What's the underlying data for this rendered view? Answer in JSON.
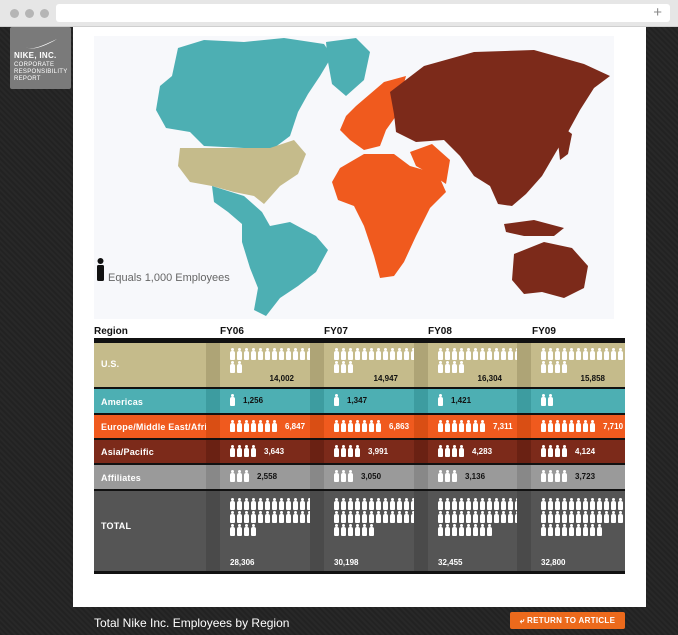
{
  "brand": {
    "name": "NIKE, INC.",
    "subtitle": "CORPORATE RESPONSIBILITY REPORT"
  },
  "legend": {
    "text": "Equals 1,000 Employees"
  },
  "table": {
    "region_header": "Region",
    "years": [
      "FY06",
      "FY07",
      "FY08",
      "FY09"
    ],
    "rows": [
      {
        "label": "U.S.",
        "values": [
          "14,002",
          "14,947",
          "16,304",
          "15,858"
        ],
        "color": "#c5bb8b",
        "shade": "#aea476"
      },
      {
        "label": "Americas",
        "values": [
          "1,256",
          "1,347",
          "1,421",
          ""
        ],
        "color": "#4dafb3",
        "shade": "#3d9ca0"
      },
      {
        "label": "Europe/Middle East/Africa",
        "values": [
          "6,847",
          "6,863",
          "7,311",
          "7,710"
        ],
        "color": "#f05a1e",
        "shade": "#d94e14"
      },
      {
        "label": "Asia/Pacific",
        "values": [
          "3,643",
          "3,991",
          "4,283",
          "4,124"
        ],
        "color": "#7c2a1a",
        "shade": "#6a2113"
      },
      {
        "label": "Affiliates",
        "values": [
          "2,558",
          "3,050",
          "3,136",
          "3,723"
        ],
        "color": "#9a9a9a",
        "shade": "#888888"
      },
      {
        "label": "TOTAL",
        "values": [
          "28,306",
          "30,198",
          "32,455",
          "32,800"
        ],
        "color": "#555555",
        "shade": "#4a4a4a"
      }
    ]
  },
  "map_colors": {
    "us": "#c5bb8b",
    "americas": "#4dafb3",
    "emea": "#f05a1e",
    "asia": "#7c2a1a"
  },
  "footer": {
    "title": "Total Nike Inc. Employees by Region",
    "button": "RETURN TO ARTICLE"
  }
}
